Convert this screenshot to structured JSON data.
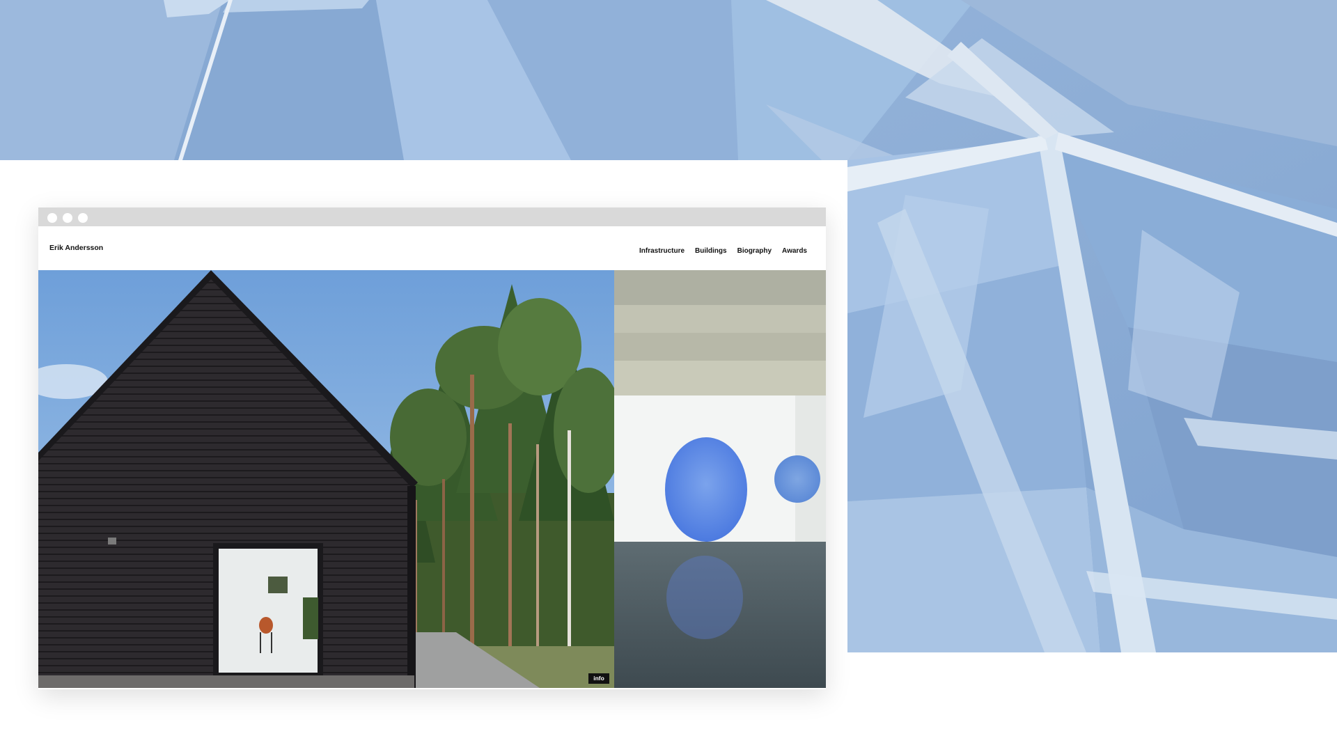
{
  "site": {
    "name": "Erik Andersson",
    "nav": [
      "Infrastructure",
      "Buildings",
      "Biography",
      "Awards"
    ],
    "info_label": "info"
  },
  "colors": {
    "background_blue": "#8fb0d8",
    "panel": "#ffffff",
    "titlebar": "#d9d9d9"
  },
  "icons": [
    "window-close-dot",
    "window-minimize-dot",
    "window-maximize-dot"
  ]
}
